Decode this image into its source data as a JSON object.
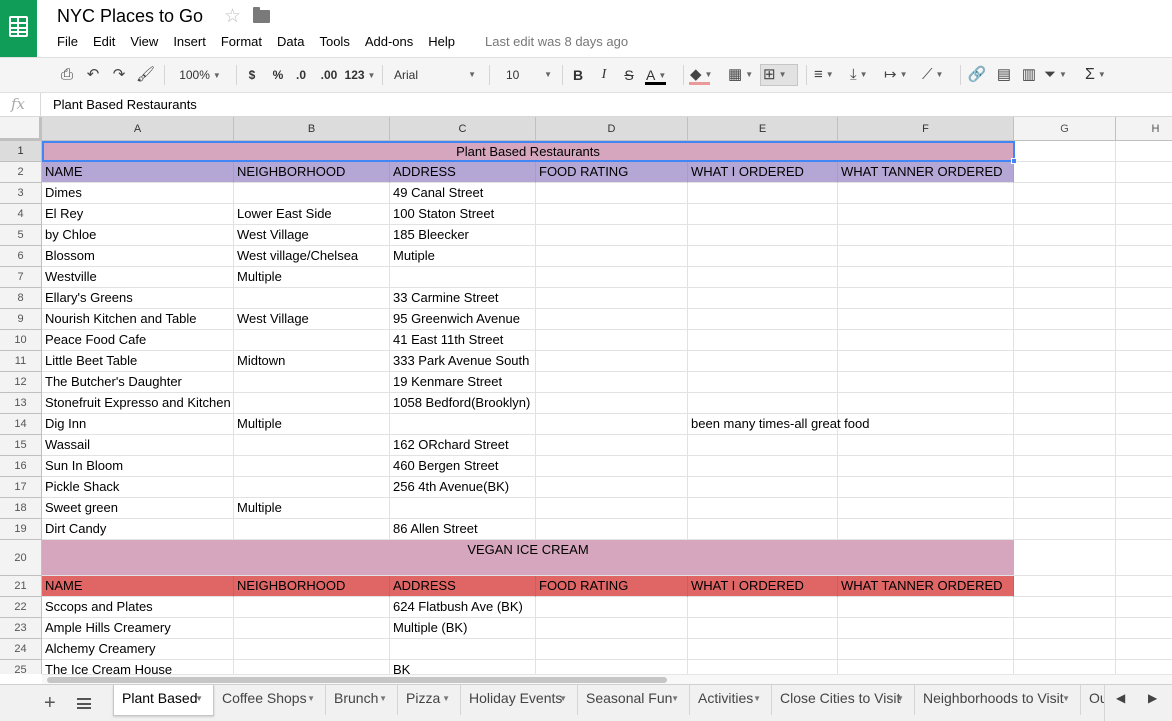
{
  "header": {
    "doc_title": "NYC Places to Go",
    "last_edit": "Last edit was 8 days ago",
    "menu": [
      "File",
      "Edit",
      "View",
      "Insert",
      "Format",
      "Data",
      "Tools",
      "Add-ons",
      "Help"
    ]
  },
  "toolbar": {
    "zoom": "100%",
    "currency": "$",
    "percent": "%",
    "decrease_decimal": ".0",
    "increase_decimal": ".00",
    "more_formats": "123",
    "font": "Arial",
    "font_size": "10",
    "bold": "B",
    "italic": "I",
    "strike": "S",
    "text_color": "A",
    "functions": "Σ"
  },
  "formula_bar": {
    "icon": "fx",
    "value": "Plant Based Restaurants"
  },
  "colors": {
    "header_fill": "#d5a6bd",
    "col_header_fill_1": "#b4a7d6",
    "col_header_fill_2": "#e06666",
    "selection": "#4285f4",
    "logo": "#0f9d58"
  },
  "grid": {
    "columns": [
      "A",
      "B",
      "C",
      "D",
      "E",
      "F",
      "G",
      "H"
    ],
    "rows": [
      {
        "num": "1",
        "merged": "Plant Based Restaurants"
      },
      {
        "num": "2",
        "cells": [
          "NAME",
          "NEIGHBORHOOD",
          "ADDRESS",
          "FOOD RATING",
          "WHAT I ORDERED",
          "WHAT TANNER ORDERED"
        ]
      },
      {
        "num": "3",
        "cells": [
          "Dimes",
          "",
          "49 Canal Street",
          "",
          "",
          ""
        ]
      },
      {
        "num": "4",
        "cells": [
          "El Rey",
          "Lower East Side",
          "100 Staton Street",
          "",
          "",
          ""
        ]
      },
      {
        "num": "5",
        "cells": [
          "by Chloe",
          "West Village",
          "185 Bleecker",
          "",
          "",
          ""
        ]
      },
      {
        "num": "6",
        "cells": [
          "Blossom",
          "West village/Chelsea",
          "Mutiple",
          "",
          "",
          ""
        ]
      },
      {
        "num": "7",
        "cells": [
          "Westville",
          "Multiple",
          "",
          "",
          "",
          ""
        ]
      },
      {
        "num": "8",
        "cells": [
          "Ellary's Greens",
          "",
          "33 Carmine Street",
          "",
          "",
          ""
        ]
      },
      {
        "num": "9",
        "cells": [
          "Nourish Kitchen and Table",
          "West Village",
          "95 Greenwich Avenue",
          "",
          "",
          ""
        ]
      },
      {
        "num": "10",
        "cells": [
          "Peace Food Cafe",
          "",
          "41 East 11th Street",
          "",
          "",
          ""
        ]
      },
      {
        "num": "11",
        "cells": [
          "Little Beet Table",
          "Midtown",
          "333 Park Avenue South",
          "",
          "",
          ""
        ]
      },
      {
        "num": "12",
        "cells": [
          "The Butcher's Daughter",
          "",
          "19 Kenmare Street",
          "",
          "",
          ""
        ]
      },
      {
        "num": "13",
        "cells": [
          "Stonefruit Expresso and Kitchen",
          "",
          "1058 Bedford(Brooklyn)",
          "",
          "",
          ""
        ]
      },
      {
        "num": "14",
        "cells": [
          "Dig Inn",
          "Multiple",
          "",
          "",
          "been many times-all great food",
          ""
        ]
      },
      {
        "num": "15",
        "cells": [
          "Wassail",
          "",
          "162 ORchard Street",
          "",
          "",
          ""
        ]
      },
      {
        "num": "16",
        "cells": [
          "Sun In Bloom",
          "",
          "460 Bergen Street",
          "",
          "",
          ""
        ]
      },
      {
        "num": "17",
        "cells": [
          "Pickle Shack",
          "",
          "256 4th Avenue(BK)",
          "",
          "",
          ""
        ]
      },
      {
        "num": "18",
        "cells": [
          "Sweet green",
          "Multiple",
          "",
          "",
          "",
          ""
        ]
      },
      {
        "num": "19",
        "cells": [
          "Dirt Candy",
          "",
          "86 Allen Street",
          "",
          "",
          ""
        ]
      },
      {
        "num": "20",
        "merged": "VEGAN ICE CREAM"
      },
      {
        "num": "21",
        "cells": [
          "NAME",
          "NEIGHBORHOOD",
          "ADDRESS",
          "FOOD RATING",
          "WHAT I ORDERED",
          "WHAT TANNER ORDERED"
        ]
      },
      {
        "num": "22",
        "cells": [
          "Sccops and Plates",
          "",
          "624 Flatbush Ave (BK)",
          "",
          "",
          ""
        ]
      },
      {
        "num": "23",
        "cells": [
          "Ample Hills Creamery",
          "",
          "Multiple (BK)",
          "",
          "",
          ""
        ]
      },
      {
        "num": "24",
        "cells": [
          "Alchemy Creamery",
          "",
          "",
          "",
          "",
          ""
        ]
      },
      {
        "num": "25",
        "cells": [
          "The Ice Cream House",
          "",
          "BK",
          "",
          "",
          ""
        ]
      }
    ]
  },
  "sheet_tabs": [
    "Plant Based",
    "Coffee Shops",
    "Brunch",
    "Pizza",
    "Holiday Events",
    "Seasonal Fun",
    "Activities",
    "Close Cities to Visit",
    "Neighborhoods to Visit",
    "Ou"
  ]
}
